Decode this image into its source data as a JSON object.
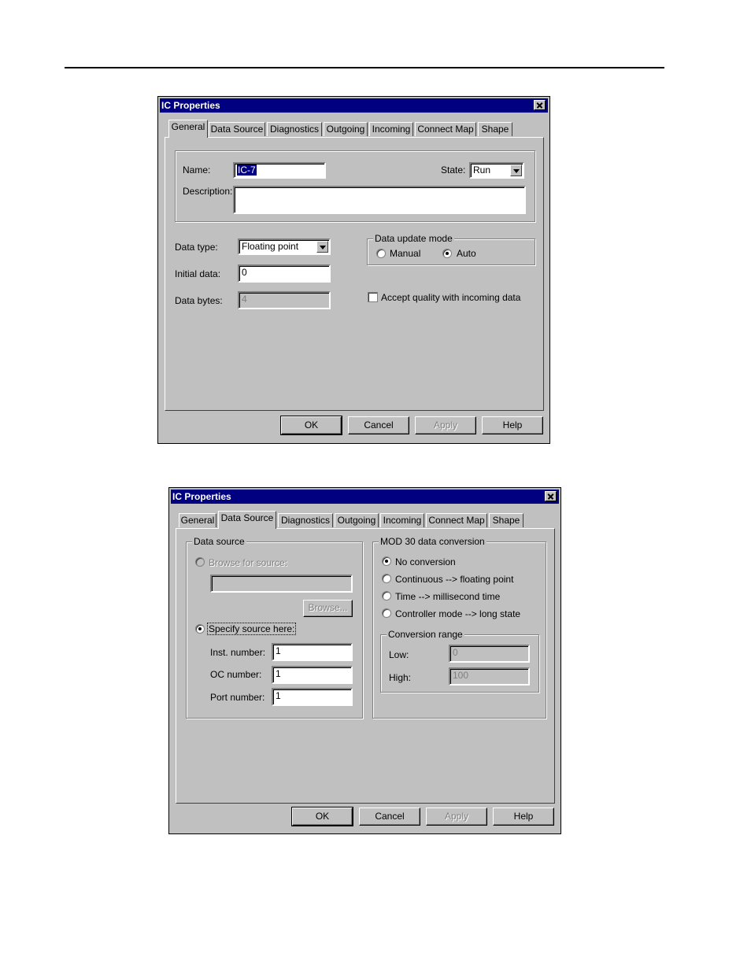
{
  "dialog1": {
    "title": "IC Properties",
    "tabs": [
      "General",
      "Data Source",
      "Diagnostics",
      "Outgoing",
      "Incoming",
      "Connect Map",
      "Shape"
    ],
    "active_tab": "General",
    "name_label": "Name:",
    "name_value": "IC-7",
    "state_label": "State:",
    "state_value": "Run",
    "description_label": "Description:",
    "description_value": "",
    "data_type_label": "Data type:",
    "data_type_value": "Floating point",
    "initial_data_label": "Initial data:",
    "initial_data_value": "0",
    "data_bytes_label": "Data bytes:",
    "data_bytes_value": "4",
    "update_mode_title": "Data update mode",
    "manual_label": "Manual",
    "auto_label": "Auto",
    "update_mode_selected": "Auto",
    "accept_quality_label": "Accept quality with incoming data",
    "accept_quality_checked": false,
    "buttons": {
      "ok": "OK",
      "cancel": "Cancel",
      "apply": "Apply",
      "help": "Help"
    }
  },
  "dialog2": {
    "title": "IC Properties",
    "tabs": [
      "General",
      "Data Source",
      "Diagnostics",
      "Outgoing",
      "Incoming",
      "Connect Map",
      "Shape"
    ],
    "active_tab": "Data Source",
    "data_source_title": "Data source",
    "browse_radio_label": "Browse for source:",
    "browse_path_value": "",
    "browse_button": "Browse...",
    "specify_radio_label": "Specify source here:",
    "source_selected": "Specify source here:",
    "inst_number_label": "Inst. number:",
    "inst_number_value": "1",
    "oc_number_label": "OC number:",
    "oc_number_value": "1",
    "port_number_label": "Port number:",
    "port_number_value": "1",
    "mod30_title": "MOD 30 data conversion",
    "conversion_options": [
      "No conversion",
      "Continuous --> floating point",
      "Time --> millisecond time",
      "Controller mode --> long state"
    ],
    "conversion_selected": "No conversion",
    "range_title": "Conversion range",
    "low_label": "Low:",
    "low_value": "0",
    "high_label": "High:",
    "high_value": "100",
    "buttons": {
      "ok": "OK",
      "cancel": "Cancel",
      "apply": "Apply",
      "help": "Help"
    }
  }
}
